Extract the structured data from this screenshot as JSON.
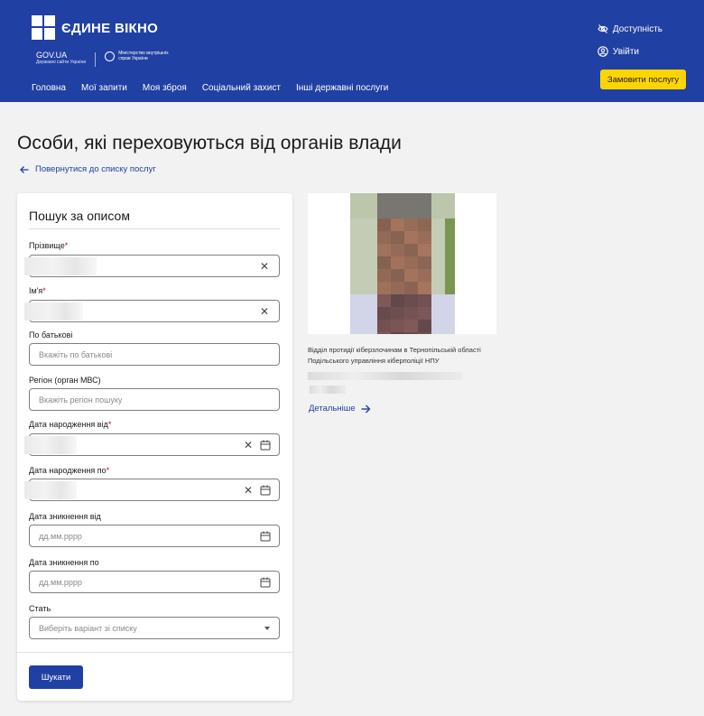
{
  "header": {
    "logo_text": "ЄДИНЕ ВІКНО",
    "gov_label": "GOV.UA",
    "gov_sub": "Державні сайти України",
    "ministry": "Міністерство внутрішніх справ України",
    "accessibility": "Доступність",
    "login": "Увійти",
    "order_button": "Замовити послугу",
    "nav": [
      "Головна",
      "Мої запити",
      "Моя зброя",
      "Соціальний захист",
      "Інші державні послуги"
    ],
    "colors": {
      "brand": "#2140a3",
      "accent": "#ffd500"
    }
  },
  "page": {
    "title": "Особи, які переховуються від органів влади",
    "back_link": "Повернутися до списку послуг"
  },
  "form": {
    "title": "Пошук за описом",
    "surname": {
      "label": "Прізвище",
      "required_mark": "*"
    },
    "name": {
      "label": "Ім'я",
      "required_mark": "*"
    },
    "patronymic": {
      "label": "По батькові",
      "placeholder": "Вкажіть по батькові"
    },
    "region": {
      "label": "Регіон (орган МВС)",
      "placeholder": "Вкажіть регіон пошуку"
    },
    "birth_from": {
      "label": "Дата народження від",
      "required_mark": "*"
    },
    "birth_to": {
      "label": "Дата народження по",
      "required_mark": "*"
    },
    "missing_from": {
      "label": "Дата зникнення від",
      "placeholder": "дд.мм.рррр"
    },
    "missing_to": {
      "label": "Дата зникнення по",
      "placeholder": "дд.мм.рррр"
    },
    "sex": {
      "label": "Стать",
      "placeholder": "Виберіть варіант зі списку"
    },
    "search_button": "Шукати"
  },
  "result": {
    "department_line1": "Відділ протидії кіберзлочинам в Тернопільській області",
    "department_line2": "Подільського управління кіберполіції НПУ",
    "details_link": "Детальніше"
  }
}
